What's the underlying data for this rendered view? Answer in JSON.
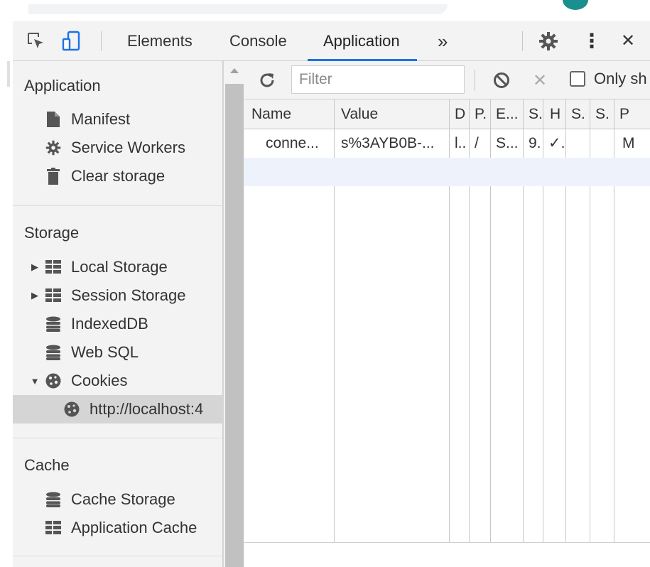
{
  "toolbar": {
    "tabs": [
      {
        "label": "Elements"
      },
      {
        "label": "Console"
      },
      {
        "label": "Application"
      }
    ],
    "more_label": "»",
    "close_label": "✕",
    "menu_label": "⋮"
  },
  "sidebar": {
    "application": {
      "title": "Application",
      "items": [
        {
          "label": "Manifest",
          "icon": "file-icon"
        },
        {
          "label": "Service Workers",
          "icon": "gear-icon"
        },
        {
          "label": "Clear storage",
          "icon": "trash-icon"
        }
      ]
    },
    "storage": {
      "title": "Storage",
      "items": [
        {
          "label": "Local Storage",
          "icon": "grid-icon"
        },
        {
          "label": "Session Storage",
          "icon": "grid-icon"
        },
        {
          "label": "IndexedDB",
          "icon": "database-icon"
        },
        {
          "label": "Web SQL",
          "icon": "database-icon"
        },
        {
          "label": "Cookies",
          "icon": "cookie-icon"
        },
        {
          "label": "http://localhost:4",
          "icon": "cookie-icon"
        }
      ]
    },
    "cache": {
      "title": "Cache",
      "items": [
        {
          "label": "Cache Storage",
          "icon": "database-icon"
        },
        {
          "label": "Application Cache",
          "icon": "grid-icon"
        }
      ]
    }
  },
  "filter": {
    "placeholder": "Filter",
    "only_label": "Only sh",
    "clear_label": "✕"
  },
  "table": {
    "headers": [
      "Name",
      "Value",
      "D",
      "P.",
      "E...",
      "S.",
      "H",
      "S.",
      "S.",
      "P"
    ],
    "rows": [
      [
        "conne...",
        "s%3AYB0B-...",
        "l..",
        "/",
        "S...",
        "9.",
        "✓.",
        "",
        "",
        "M"
      ]
    ]
  },
  "colors": {
    "accent": "#1a73e8",
    "panel_bg": "#f3f3f3",
    "selected_bg": "#d5d5d5"
  }
}
